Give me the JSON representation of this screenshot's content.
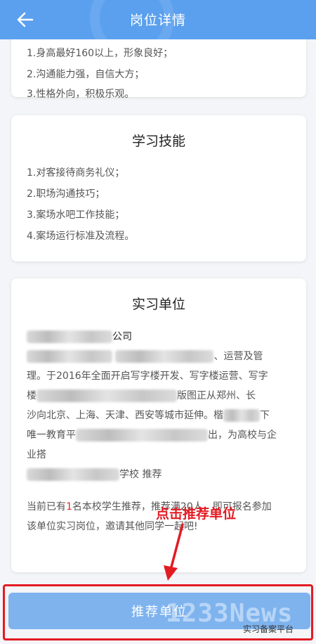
{
  "header": {
    "title": "岗位详情"
  },
  "requirements_card": {
    "cut_line": "1.身高最好160以上，形象良好；",
    "items": [
      "2.沟通能力强，自信大方；",
      "3.性格外向，积极乐观。"
    ]
  },
  "skills_card": {
    "title": "学习技能",
    "items": [
      "1.对客接待商务礼仪；",
      "2.职场沟通技巧；",
      "3.案场水吧工作技能；",
      "4.案场运行标准及流程。"
    ]
  },
  "company_card": {
    "title": "实习单位",
    "name_suffix": "公司",
    "line1_end": "、运营及管",
    "line2": "理。于2016年全面开启写字楼开发、写字楼运营、写字",
    "line3_start": "楼",
    "line3_end": "版图正从郑州、长",
    "line4_start": "沙向北京、上海、天津、西安等城市延伸。楷",
    "line4_end": "下",
    "line5_start": "唯一教育平",
    "line5_end": "出，为高校与企",
    "line6": "业搭",
    "recommend_suffix": "学校 推荐",
    "notice_prefix": "当前已有",
    "notice_count": "1",
    "notice_mid": "名本校学生推荐，推荐满20人，即可报名参加",
    "notice_line2": "该单位实习岗位，邀请其他同学一起吧!"
  },
  "annotation": {
    "text": "点击推荐单位"
  },
  "cta": {
    "label": "推荐单位"
  },
  "watermark": {
    "big": "1233News",
    "small": "实习备案平台"
  },
  "colors": {
    "header": "#5aa0ee",
    "cta": "#7eb3ee",
    "highlight": "#e31b23"
  }
}
